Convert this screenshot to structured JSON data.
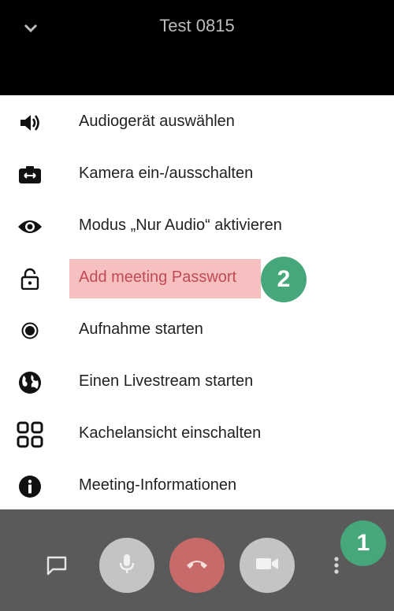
{
  "header": {
    "title": "Test 0815",
    "collapse_icon": "chevron-down-icon"
  },
  "menu": {
    "items": [
      {
        "label": "Audiogerät auswählen",
        "icon": "speaker-icon"
      },
      {
        "label": "Kamera ein-/ausschalten",
        "icon": "camera-switch-icon"
      },
      {
        "label": "Modus „Nur Audio“ aktivieren",
        "icon": "eye-icon"
      },
      {
        "label": "Add meeting Passwort",
        "icon": "lock-icon",
        "highlighted": true
      },
      {
        "label": "Aufnahme starten",
        "icon": "record-icon"
      },
      {
        "label": "Einen Livestream starten",
        "icon": "globe-icon"
      },
      {
        "label": "Kachelansicht einschalten",
        "icon": "grid-icon"
      },
      {
        "label": "Meeting-Informationen",
        "icon": "info-icon"
      }
    ]
  },
  "annotations": {
    "badge1": "1",
    "badge2": "2"
  },
  "toolbar": {
    "chat_icon": "chat-icon",
    "mic_icon": "microphone-icon",
    "hangup_icon": "hangup-icon",
    "video_icon": "video-camera-icon",
    "more_icon": "more-vert-icon"
  },
  "colors": {
    "highlight": "#f7c0c0",
    "badge": "#46a77b",
    "hangup": "#c96a6a",
    "control": "#c4c4c4",
    "toolbar": "#5a5a5a"
  }
}
